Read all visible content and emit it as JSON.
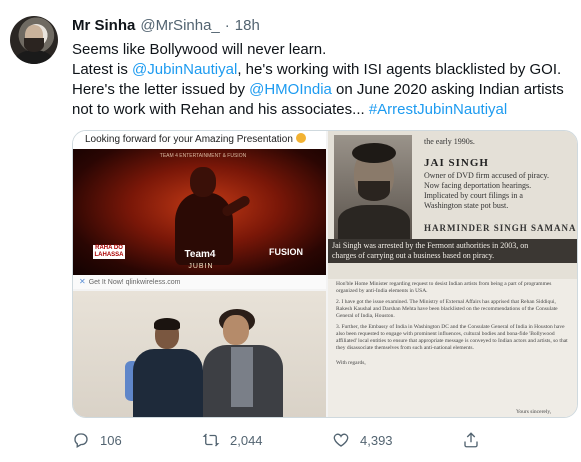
{
  "tweet": {
    "author_name": "Mr Sinha",
    "author_handle": "@MrSinha_",
    "separator": "·",
    "time": "18h",
    "text_lines": [
      [
        {
          "t": "Seems like Bollywood will never learn.",
          "link": false
        }
      ],
      [
        {
          "t": "Latest is ",
          "link": false
        },
        {
          "t": "@JubinNautiyal",
          "link": true
        },
        {
          "t": ", he's working with ISI agents blacklisted by GOI.",
          "link": false
        }
      ],
      [
        {
          "t": "Here's the letter issued by ",
          "link": false
        },
        {
          "t": "@HMOIndia",
          "link": true
        },
        {
          "t": " on June 2020 asking Indian artists",
          "link": false
        }
      ],
      [
        {
          "t": "not to work with Rehan and his associates... ",
          "link": false
        },
        {
          "t": "#ArrestJubinNautiyal",
          "link": true
        }
      ]
    ]
  },
  "media": {
    "ad": {
      "headline": "Looking forward for your Amazing Presentation",
      "top_small": "TEAM 4 ENTERTAINMENT & FUSION",
      "badge_left": "RAHA DO LAHASSA",
      "team": "Team4",
      "team_sub": "JUBIN",
      "fusion": "FUSION",
      "footer": "Get It Now! qlinkwireless.com",
      "close_icon_text": "✕"
    },
    "clipping": {
      "top_text": "the early 1990s.",
      "name": "JAI SINGH",
      "desc_lines": [
        "Owner of DVD firm accused of piracy.",
        "Now facing deportation hearings.",
        "Implicated by court filings in a",
        "Washington state pot bust."
      ],
      "second_name": "HARMINDER SINGH SAMANA",
      "caption_lines": [
        "Jai Singh was arrested by the Fermont authorities in 2003, on",
        "charges of carrying out a business based on piracy."
      ]
    },
    "letter": {
      "para0": "Hon'ble Home Minister regarding request to desist Indian artists from being a part of programmes organized by anti-India elements in USA.",
      "para1": "2.     I have got the issue examined. The Ministry of External Affairs has apprised that Rehan Siddiqui, Rakesh Kaushal and Darshan Mehta have been blacklisted on the recommendations of the Consulate General of India, Houston.",
      "para2": "3.     Further, the Embassy of India in Washington DC and the Consulate General of India in Houston have also been requested to engage with prominent influences, cultural bodies and bona-fide 'Bollywood affiliated' local entities to ensure that appropriate message is conveyed to Indian actors and artists, so that they disassociate themselves from such anti-national elements.",
      "regards": "With regards,",
      "yours": "Yours sincerely,"
    }
  },
  "actions": {
    "replies": "106",
    "retweets": "2,044",
    "likes": "4,393"
  },
  "colors": {
    "link": "#1d9bf0",
    "secondary": "#536471",
    "text": "#0f1419"
  },
  "icons": {
    "reply": "reply-icon",
    "retweet": "retweet-icon",
    "like": "heart-icon",
    "share": "share-icon"
  }
}
